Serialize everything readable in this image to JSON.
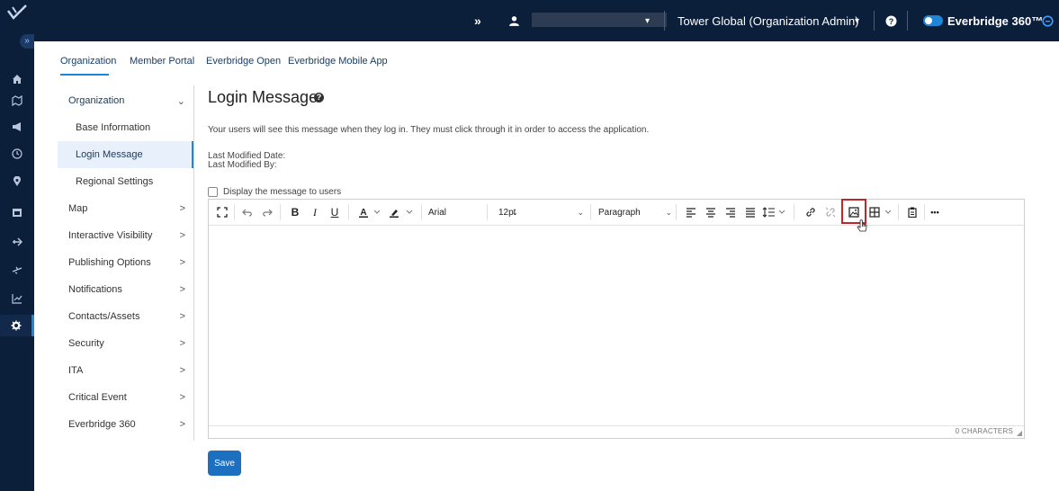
{
  "colors": {
    "nav_bg": "#0b1f3a",
    "accent": "#1d86d8",
    "save_bg": "#1d6fbf",
    "highlight": "#c0272d"
  },
  "rail": {
    "icons": [
      "logo-icon",
      "expand-icon",
      "home-icon",
      "map-icon",
      "megaphone-icon",
      "clock-icon",
      "pin-icon",
      "calendar-icon",
      "plane-icon",
      "flight-icon",
      "chart-icon",
      "settings-icon"
    ],
    "expand_glyph": "»"
  },
  "topbar": {
    "forward_glyph": "»",
    "user_icon": "user-icon",
    "user_caret": "▾",
    "org_label": "Tower Global (Organization Admin)",
    "org_caret": "▾",
    "help_icon": "help-icon",
    "product_label": "Everbridge 360™",
    "product_icon": "info-circle-icon"
  },
  "tabs": [
    {
      "label": "Organization"
    },
    {
      "label": "Member Portal"
    },
    {
      "label": "Everbridge Open"
    },
    {
      "label": "Everbridge Mobile App"
    }
  ],
  "sidebar": {
    "items": [
      {
        "label": "Organization",
        "chev": "⌄"
      },
      {
        "label": "Base Information",
        "chev": ""
      },
      {
        "label": "Login Message",
        "chev": ""
      },
      {
        "label": "Regional Settings",
        "chev": ""
      },
      {
        "label": "Map",
        "chev": ">"
      },
      {
        "label": "Interactive Visibility",
        "chev": ">"
      },
      {
        "label": "Publishing Options",
        "chev": ">"
      },
      {
        "label": "Notifications",
        "chev": ">"
      },
      {
        "label": "Contacts/Assets",
        "chev": ">"
      },
      {
        "label": "Security",
        "chev": ">"
      },
      {
        "label": "ITA",
        "chev": ">"
      },
      {
        "label": "Critical Event",
        "chev": ">"
      },
      {
        "label": "Everbridge 360",
        "chev": ">"
      }
    ]
  },
  "main": {
    "title": "Login Message",
    "help_glyph": "?",
    "description": "Your users will see this message when they log in. They must click through it in order to access the application.",
    "last_modified_date_label": "Last Modified Date:",
    "last_modified_by_label": "Last Modified By:",
    "display_checkbox_label": "Display the message to users",
    "display_checked": false,
    "save_label": "Save"
  },
  "editor": {
    "bold": "B",
    "italic": "I",
    "underline": "U",
    "font_family": "Arial",
    "font_size": "12pt",
    "block_format": "Paragraph",
    "more": "•••",
    "char_count": "0 CHARACTERS",
    "caret": "⌄"
  }
}
